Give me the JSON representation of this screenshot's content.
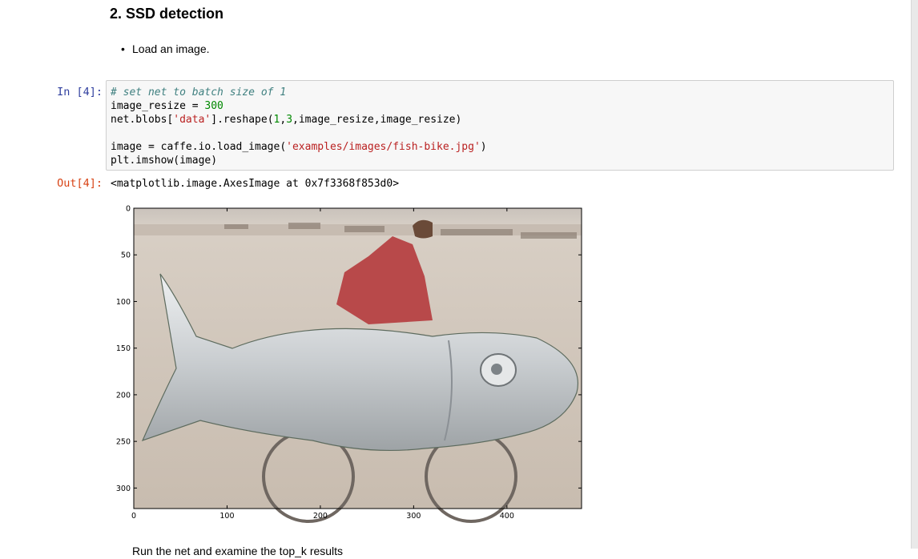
{
  "notebook": {
    "heading": "2. SSD detection",
    "bullets": [
      "Load an image."
    ],
    "cell": {
      "in_prompt": "In [4]:",
      "code_lines": [
        [
          {
            "t": "# set net to batch size of 1",
            "c": "cm"
          }
        ],
        [
          {
            "t": "image_resize = ",
            "c": ""
          },
          {
            "t": "300",
            "c": "num"
          }
        ],
        [
          {
            "t": "net.blobs[",
            "c": ""
          },
          {
            "t": "'data'",
            "c": "str"
          },
          {
            "t": "].reshape(",
            "c": ""
          },
          {
            "t": "1",
            "c": "num"
          },
          {
            "t": ",",
            "c": ""
          },
          {
            "t": "3",
            "c": "num"
          },
          {
            "t": ",image_resize,image_resize)",
            "c": ""
          }
        ],
        [
          {
            "t": "",
            "c": ""
          }
        ],
        [
          {
            "t": "image = caffe.io.load_image(",
            "c": ""
          },
          {
            "t": "'examples/images/fish-bike.jpg'",
            "c": "str"
          },
          {
            "t": ")",
            "c": ""
          }
        ],
        [
          {
            "t": "plt.imshow(image)",
            "c": ""
          }
        ]
      ],
      "out_prompt": "Out[4]:",
      "output_text": "<matplotlib.image.AxesImage at 0x7f3368f853d0>"
    },
    "next_bullet_partial": "Run the net and examine the top_k results"
  },
  "plot": {
    "image_description_icon": "fish-bike-photo",
    "x_ticks": [
      "0",
      "100",
      "200",
      "300",
      "400"
    ],
    "x_tick_values": [
      0,
      100,
      200,
      300,
      400
    ],
    "y_ticks": [
      "0",
      "50",
      "100",
      "150",
      "200",
      "250",
      "300"
    ],
    "y_tick_values": [
      0,
      50,
      100,
      150,
      200,
      250,
      300
    ],
    "x_range": [
      0,
      480
    ],
    "y_range": [
      0,
      322
    ]
  },
  "colors": {
    "in_prompt": "#303f9f",
    "out_prompt": "#d84315",
    "comment": "#408080",
    "number": "#008800",
    "string": "#ba2121"
  }
}
